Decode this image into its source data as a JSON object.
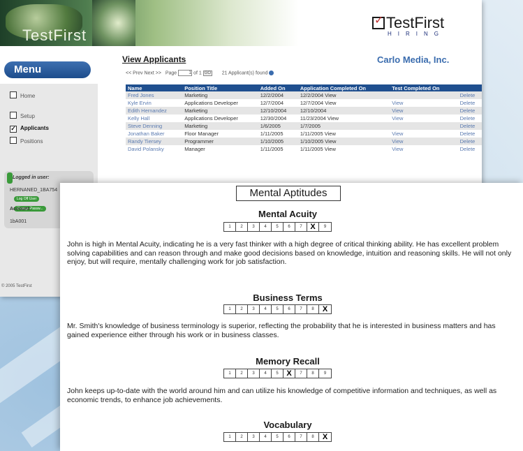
{
  "banner": {
    "title": "TestFirst"
  },
  "logo": {
    "name": "TestFirst",
    "subtitle": "HIRING"
  },
  "menu": {
    "label": "Menu",
    "items": [
      {
        "label": "Home",
        "checked": false
      },
      {
        "label": "Setup",
        "checked": false
      },
      {
        "label": "Applicants",
        "checked": true
      },
      {
        "label": "Positions",
        "checked": false
      }
    ]
  },
  "user_panel": {
    "logged_label": "Logged in user:",
    "user_id": "HERNANED_1BA754",
    "logoff_label": "Log Off User",
    "change_pw_label": "Change Passw..."
  },
  "account": {
    "label": "Account:",
    "value": "1bA001"
  },
  "copyright": "© 2005 TestFirst",
  "main": {
    "title": "View Applicants",
    "company": "Carlo Media, Inc.",
    "pager": {
      "prev_next": "<< Prev Next >>",
      "page_label": "Page",
      "page_value": "1",
      "of_label": "of 1",
      "go_label": "GO",
      "found_text": "21 Applicant(s) found"
    },
    "table": {
      "headers": [
        "Name",
        "Position Title",
        "Added On",
        "Application Completed On",
        "Test Completed On",
        ""
      ],
      "rows": [
        [
          "Fred Jones",
          "Marketing",
          "12/2/2004",
          "12/2/2004 View",
          "",
          "Delete"
        ],
        [
          "Kyle Ervin",
          "Applications Developer",
          "12/7/2004",
          "12/7/2004 View",
          "View",
          "Delete"
        ],
        [
          "Edith Hernandez",
          "Marketing",
          "12/10/2004",
          "12/10/2004",
          "View",
          "Delete"
        ],
        [
          "Kelly Hall",
          "Applications Developer",
          "12/30/2004",
          "11/23/2004 View",
          "View",
          "Delete"
        ],
        [
          "Steve Denning",
          "Marketing",
          "1/6/2005",
          "1/7/2005",
          "",
          "Delete"
        ],
        [
          "Jonathan Baker",
          "Floor Manager",
          "1/11/2005",
          "1/11/2005 View",
          "View",
          "Delete"
        ],
        [
          "Randy Tiersey",
          "Programmer",
          "1/10/2005",
          "1/10/2005 View",
          "View",
          "Delete"
        ],
        [
          "David Polansky",
          "Manager",
          "1/11/2005",
          "1/11/2005 View",
          "View",
          "Delete"
        ]
      ]
    }
  },
  "report": {
    "title": "Mental Aptitudes",
    "sections": [
      {
        "title": "Mental Acuity",
        "score": 8,
        "text": "John is high in Mental Acuity, indicating he is a very fast thinker with a high degree of critical thinking ability.  He has excellent problem solving capabilities and can reason through and make good decisions based on knowledge, intuition and reasoning skills.  He will not only enjoy, but will require, mentally challenging work for job satisfaction."
      },
      {
        "title": "Business Terms",
        "score": 9,
        "text": "Mr. Smith's knowledge of business terminology is superior, reflecting the probability that he is interested in business matters and has gained experience either through his work or in business classes."
      },
      {
        "title": "Memory Recall",
        "score": 6,
        "text": "John keeps up-to-date with the world around him and can utilize his knowledge of competitive information and techniques, as well as economic trends, to enhance job achievements."
      },
      {
        "title": "Vocabulary",
        "score": 9,
        "text": ""
      }
    ],
    "scale_mark": "X"
  }
}
